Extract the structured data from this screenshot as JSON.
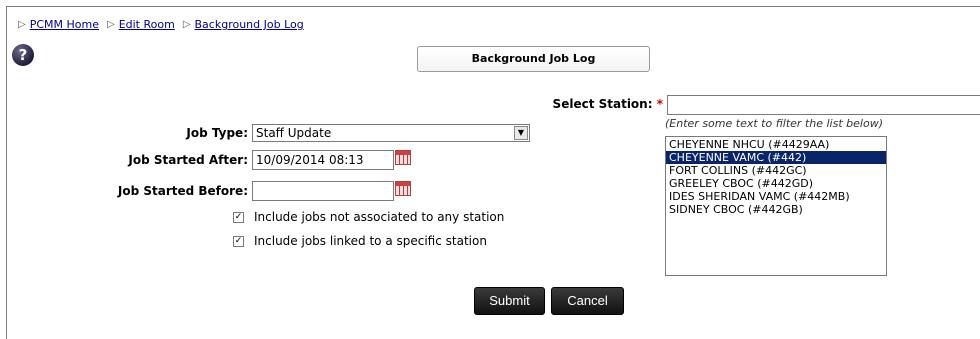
{
  "breadcrumb": {
    "items": [
      {
        "label": "PCMM Home"
      },
      {
        "label": "Edit Room"
      },
      {
        "label": "Background Job Log"
      }
    ]
  },
  "page_title": "Background Job Log",
  "station": {
    "label": "Select Station:",
    "required_mark": "*",
    "filter_value": "",
    "hint": "(Enter some text to filter the list below)",
    "options": [
      {
        "label": "CHEYENNE NHCU (#4429AA)",
        "selected": false
      },
      {
        "label": "CHEYENNE VAMC (#442)",
        "selected": true
      },
      {
        "label": "FORT COLLINS (#442GC)",
        "selected": false
      },
      {
        "label": "GREELEY CBOC (#442GD)",
        "selected": false
      },
      {
        "label": "IDES SHERIDAN VAMC (#442MB)",
        "selected": false
      },
      {
        "label": "SIDNEY CBOC (#442GB)",
        "selected": false
      }
    ]
  },
  "job_type": {
    "label": "Job Type:",
    "value": "Staff Update"
  },
  "started_after": {
    "label": "Job Started After:",
    "value": "10/09/2014 08:13"
  },
  "started_before": {
    "label": "Job Started Before:",
    "value": ""
  },
  "checkboxes": {
    "no_station": {
      "label": "Include jobs not associated to any station",
      "checked": true
    },
    "specific_station": {
      "label": "Include jobs linked to a specific station",
      "checked": true
    }
  },
  "buttons": {
    "submit": "Submit",
    "cancel": "Cancel"
  }
}
